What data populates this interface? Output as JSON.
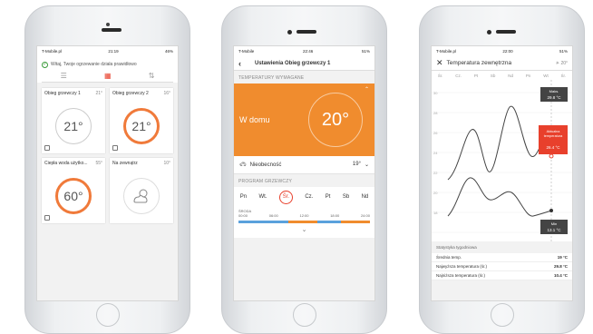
{
  "phone1": {
    "status": {
      "carrier": "T-Mobile.pl",
      "net": "LTE",
      "time": "21:19",
      "battery": "46%"
    },
    "message": "Witaj, Twoje ogrzewanie działa prawidłowo",
    "tiles": [
      {
        "name": "Obieg grzewczy 1",
        "setpoint": "21°",
        "temp": "21°",
        "active": false
      },
      {
        "name": "Obieg grzewczy 2",
        "setpoint": "16°",
        "temp": "21°",
        "active": true
      },
      {
        "name": "Ciepła woda użytko...",
        "setpoint": "55°",
        "temp": "60°",
        "active": true
      },
      {
        "name": "Na zewnątrz",
        "setpoint": "10°",
        "icon": "partly-sunny-icon"
      }
    ]
  },
  "phone2": {
    "status": {
      "carrier": "T-Mobile",
      "time": "22:46",
      "battery": "51%"
    },
    "title": "Ustawienia Obieg grzewczy 1",
    "section_required": "TEMPERATURY WYMAGANE",
    "mode": "W domu",
    "mode_temp": "20°",
    "absence_label": "Nieobecność",
    "absence_value": "19°",
    "section_program": "PROGRAM GRZEWCZY",
    "days": [
      "Pn",
      "Wt.",
      "Śr.",
      "Cz.",
      "Pt",
      "Sb",
      "Nd"
    ],
    "selected_day": "Śr.",
    "day_caption": "ŚRODA",
    "times": [
      "00:00",
      "06:00",
      "12:00",
      "18:00",
      "24:00"
    ]
  },
  "phone3": {
    "status": {
      "carrier": "T-Mobile.pl",
      "time": "22:00",
      "battery": "51%"
    },
    "title": "Temperatura zewnętrzna",
    "weather": "20°",
    "days": [
      "Śr.",
      "Cz.",
      "Pt",
      "Sb",
      "Nd",
      "Pn",
      "Wt",
      "Śr."
    ],
    "y_ticks": [
      "30",
      "28",
      "26",
      "24",
      "22",
      "20",
      "18",
      "16"
    ],
    "max_label": "Maks.",
    "max_value": "29.8 °C",
    "current_label": "Aktualna temperatura",
    "current_value": "26.4 °C",
    "min_label": "Min",
    "min_value": "13.1 °C",
    "stats_title": "Statystyka tygodniowa",
    "stats": [
      {
        "label": "Średnia temp.",
        "value": "19 °C"
      },
      {
        "label": "Najwyższa temperatura (śr.)",
        "value": "29.8 °C"
      },
      {
        "label": "Najniższa temperatura (śr.)",
        "value": "10.4 °C"
      }
    ],
    "colors": {
      "accent": "#e8402c",
      "line": "#444444"
    }
  }
}
